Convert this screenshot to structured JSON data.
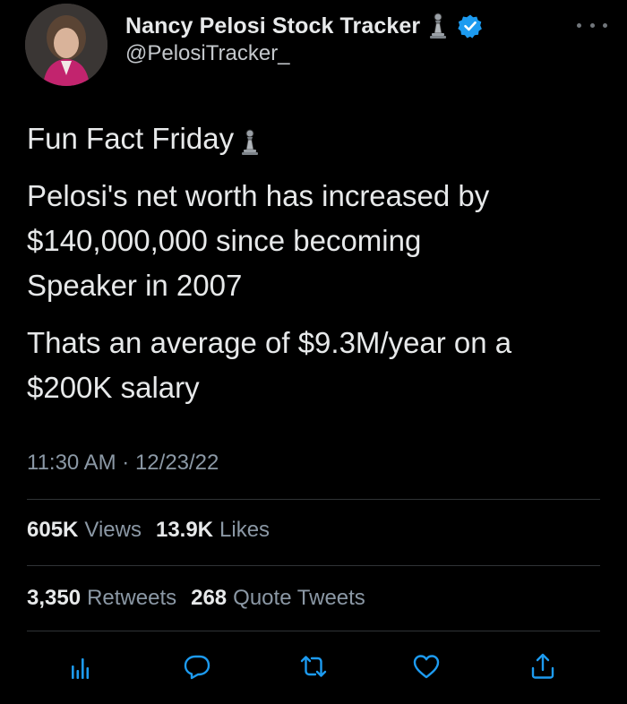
{
  "author": {
    "display_name": "Nancy Pelosi Stock Tracker",
    "handle": "@PelosiTracker_",
    "badge_icon": "chess-pawn-icon",
    "verified_icon": "verified-badge-icon",
    "verified_color": "#1d9bf0"
  },
  "tweet": {
    "line1": "Fun Fact Friday",
    "para2": [
      "Pelosi's net worth has increased by",
      "$140,000,000 since becoming",
      "Speaker in 2007"
    ],
    "para3": [
      "Thats an average of $9.3M/year on a",
      "$200K salary"
    ],
    "timestamp": "11:30 AM · 12/23/22"
  },
  "stats": {
    "views_count": "605K",
    "views_label": "Views",
    "likes_count": "13.9K",
    "likes_label": "Likes",
    "retweets_count": "3,350",
    "retweets_label": "Retweets",
    "quotes_count": "268",
    "quotes_label": "Quote Tweets"
  },
  "actions": [
    "analytics-icon",
    "reply-icon",
    "retweet-icon",
    "like-icon",
    "share-icon"
  ],
  "colors": {
    "background": "#000000",
    "text": "#e7e9ea",
    "muted": "#8b98a5",
    "action_icon": "#1d9bf0"
  }
}
